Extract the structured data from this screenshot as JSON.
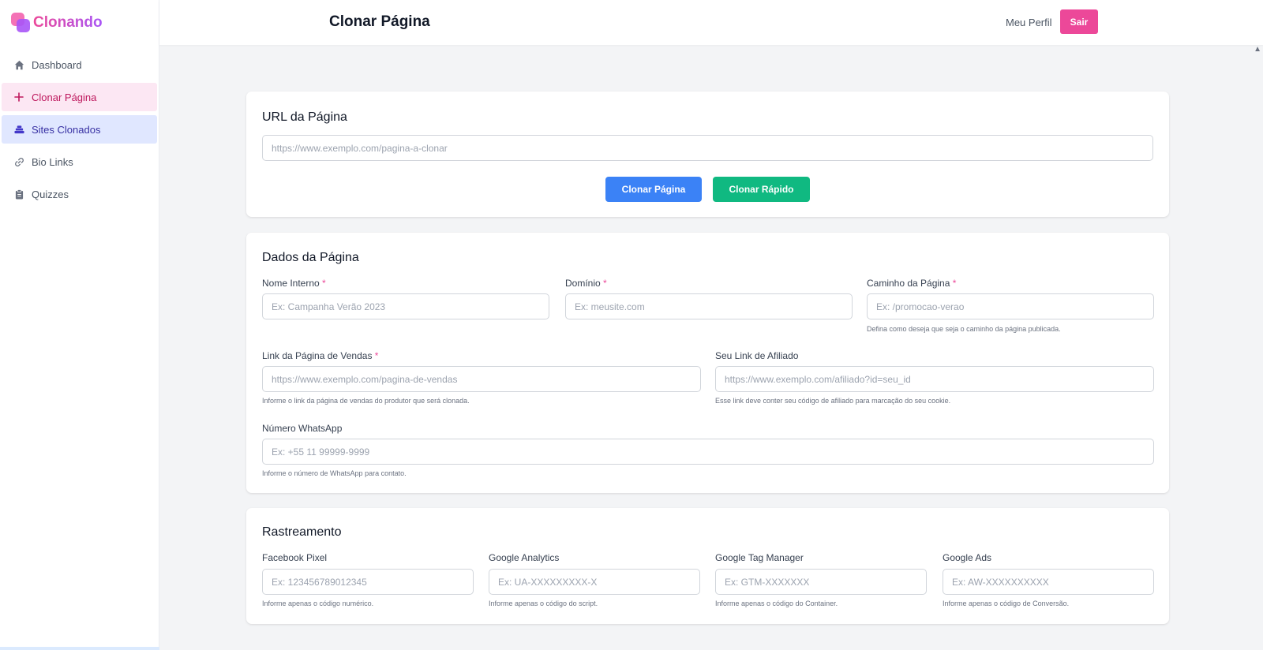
{
  "app": {
    "name": "Clonando"
  },
  "header": {
    "title": "Clonar Página",
    "profile_label": "Meu Perfil",
    "logout_label": "Sair"
  },
  "sidebar": {
    "items": [
      {
        "label": "Dashboard",
        "icon": "home-icon"
      },
      {
        "label": "Clonar Página",
        "icon": "plus-icon"
      },
      {
        "label": "Sites Clonados",
        "icon": "stack-icon"
      },
      {
        "label": "Bio Links",
        "icon": "link-icon"
      },
      {
        "label": "Quizzes",
        "icon": "clipboard-icon"
      }
    ]
  },
  "url_card": {
    "title": "URL da Página",
    "url_placeholder": "https://www.exemplo.com/pagina-a-clonar",
    "clone_button": "Clonar Página",
    "quick_clone_button": "Clonar Rápido"
  },
  "page_data_card": {
    "title": "Dados da Página",
    "internal_name": {
      "label": "Nome Interno",
      "required": "*",
      "placeholder": "Ex: Campanha Verão 2023"
    },
    "domain": {
      "label": "Domínio",
      "required": "*",
      "placeholder": "Ex: meusite.com"
    },
    "path": {
      "label": "Caminho da Página",
      "required": "*",
      "placeholder": "Ex: /promocao-verao",
      "hint": "Defina como deseja que seja o caminho da página publicada."
    },
    "sales_link": {
      "label": "Link da Página de Vendas",
      "required": "*",
      "placeholder": "https://www.exemplo.com/pagina-de-vendas",
      "hint": "Informe o link da página de vendas do produtor que será clonada."
    },
    "affiliate_link": {
      "label": "Seu Link de Afiliado",
      "placeholder": "https://www.exemplo.com/afiliado?id=seu_id",
      "hint": "Esse link deve conter seu código de afiliado para marcação do seu cookie."
    },
    "whatsapp": {
      "label": "Número WhatsApp",
      "placeholder": "Ex: +55 11 99999-9999",
      "hint": "Informe o número de WhatsApp para contato."
    }
  },
  "tracking_card": {
    "title": "Rastreamento",
    "facebook": {
      "label": "Facebook Pixel",
      "placeholder": "Ex: 123456789012345",
      "hint": "Informe apenas o código numérico."
    },
    "analytics": {
      "label": "Google Analytics",
      "placeholder": "Ex: UA-XXXXXXXXX-X",
      "hint": "Informe apenas o código do script."
    },
    "gtm": {
      "label": "Google Tag Manager",
      "placeholder": "Ex: GTM-XXXXXXX",
      "hint": "Informe apenas o código do Container."
    },
    "ads": {
      "label": "Google Ads",
      "placeholder": "Ex: AW-XXXXXXXXXX",
      "hint": "Informe apenas o código de Conversão."
    }
  },
  "colors": {
    "brand_pink": "#ec4899",
    "brand_purple": "#a855f7",
    "primary_blue": "#3b82f6",
    "success_green": "#10b981"
  }
}
